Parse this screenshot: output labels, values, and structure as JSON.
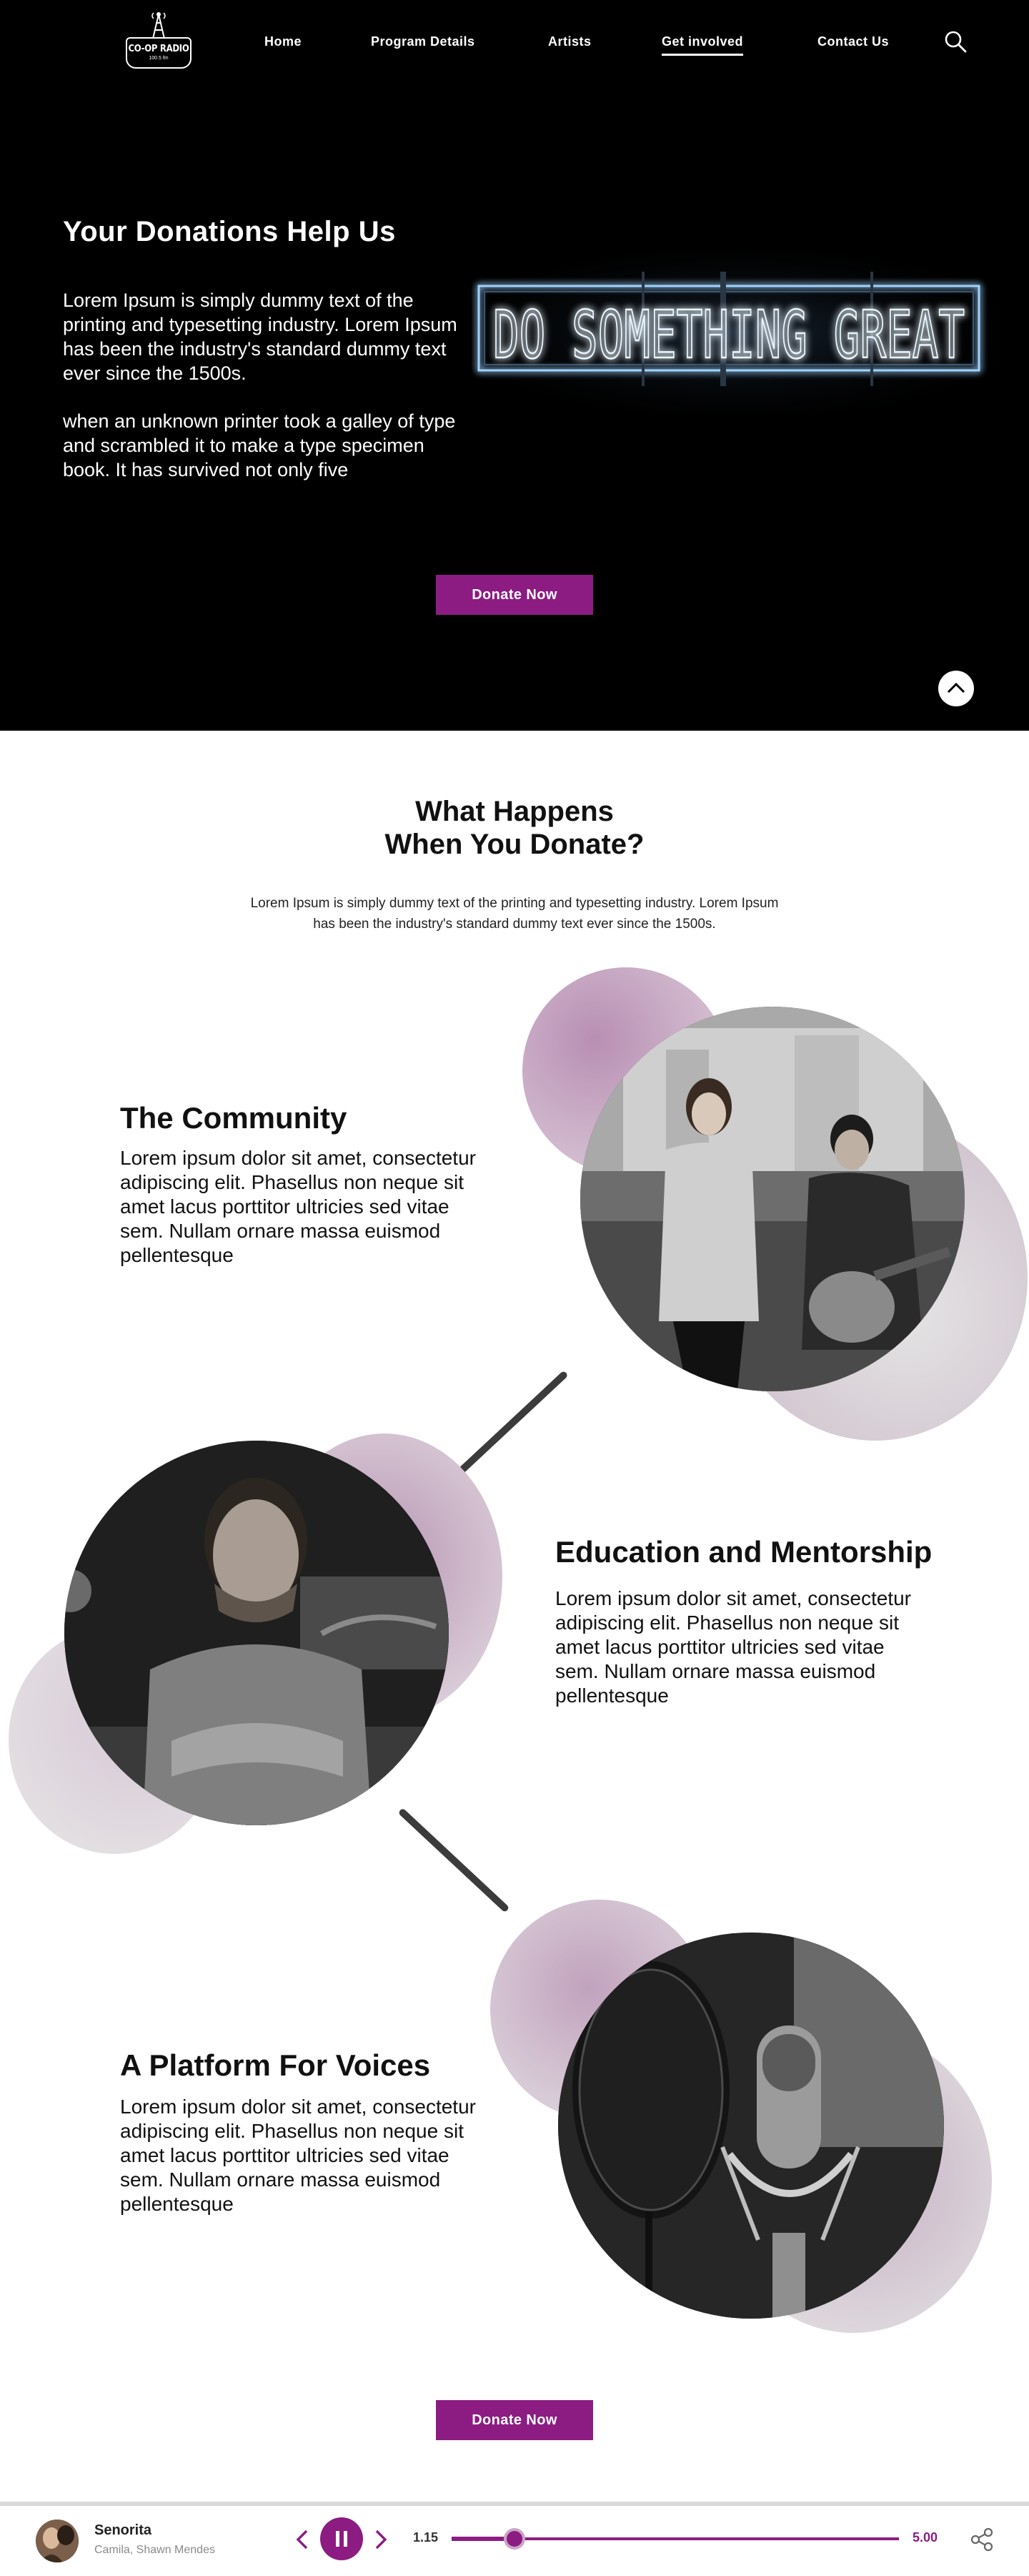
{
  "brand": {
    "logo_name": "CO-OP RADIO",
    "logo_tagline": "100.5 fm"
  },
  "nav": {
    "items": [
      {
        "label": "Home"
      },
      {
        "label": "Program Details"
      },
      {
        "label": "Artists"
      },
      {
        "label": "Get involved",
        "active": true
      },
      {
        "label": "Contact Us"
      }
    ],
    "search_icon": "search-icon"
  },
  "hero": {
    "title": "Your Donations Help Us",
    "paragraph1": "Lorem Ipsum is simply dummy text of the printing and typesetting industry. Lorem Ipsum has been the industry's standard dummy text ever since the 1500s.",
    "paragraph2": "when an unknown printer took a galley of type and scrambled it to make a type specimen book. It has survived not only five",
    "neon_sign": "DO SOMETHING GREAT",
    "donate_label": "Donate Now",
    "scroll_top_icon": "chevron-up-icon"
  },
  "impact": {
    "title_line1": "What Happens",
    "title_line2": "When You Donate?",
    "subtitle": "Lorem Ipsum is simply dummy text of the printing and typesetting industry. Lorem Ipsum has been the industry's standard dummy text ever since the 1500s.",
    "sections": [
      {
        "title": "The Community",
        "body": "Lorem ipsum dolor sit amet, consectetur adipiscing elit. Phasellus non neque sit amet lacus porttitor ultricies sed vitae sem. Nullam ornare massa euismod pellentesque"
      },
      {
        "title": "Education and Mentorship",
        "body": "Lorem ipsum dolor sit amet, consectetur adipiscing elit. Phasellus non neque sit amet lacus porttitor ultricies sed vitae sem. Nullam ornare massa euismod pellentesque"
      },
      {
        "title": "A Platform For Voices",
        "body": "Lorem ipsum dolor sit amet, consectetur adipiscing elit. Phasellus non neque sit amet lacus porttitor ultricies sed vitae sem. Nullam ornare massa euismod pellentesque"
      }
    ],
    "donate_label": "Donate Now"
  },
  "player": {
    "track": "Senorita",
    "artist": "Camila, Shawn Mendes",
    "current_time": "1.15",
    "total_time": "5.00",
    "progress": 0.14,
    "state": "playing",
    "icons": [
      "previous-icon",
      "pause-icon",
      "next-icon",
      "share-icon"
    ]
  },
  "colors": {
    "accent": "#8c1c82",
    "hero_bg": "#000000",
    "bubble": "#c9a9c6"
  }
}
